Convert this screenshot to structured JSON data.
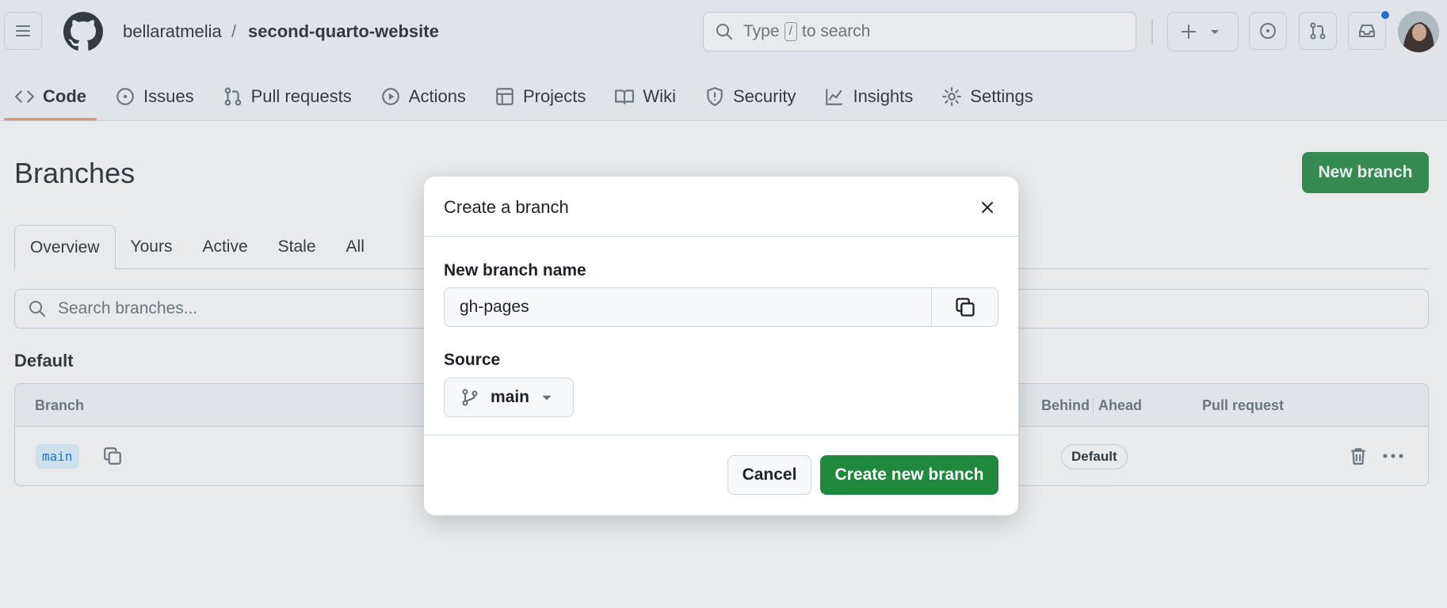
{
  "header": {
    "owner": "bellaratmelia",
    "separator": "/",
    "repo": "second-quarto-website",
    "search_prefix": "Type",
    "search_key": "/",
    "search_suffix": "to search"
  },
  "repo_tabs": [
    {
      "label": "Code",
      "icon": "code-icon"
    },
    {
      "label": "Issues",
      "icon": "issue-icon"
    },
    {
      "label": "Pull requests",
      "icon": "pull-request-icon"
    },
    {
      "label": "Actions",
      "icon": "play-icon"
    },
    {
      "label": "Projects",
      "icon": "table-icon"
    },
    {
      "label": "Wiki",
      "icon": "book-icon"
    },
    {
      "label": "Security",
      "icon": "shield-icon"
    },
    {
      "label": "Insights",
      "icon": "graph-icon"
    },
    {
      "label": "Settings",
      "icon": "gear-icon"
    }
  ],
  "page": {
    "title": "Branches",
    "new_branch_label": "New branch",
    "subtabs": [
      "Overview",
      "Yours",
      "Active",
      "Stale",
      "All"
    ],
    "search_placeholder": "Search branches...",
    "section_label": "Default",
    "table_headers": {
      "branch": "Branch",
      "behind": "Behind",
      "ahead": "Ahead",
      "pull_request": "Pull request"
    },
    "row": {
      "branch": "main",
      "badge": "Default"
    }
  },
  "dialog": {
    "title": "Create a branch",
    "name_label": "New branch name",
    "name_value": "gh-pages",
    "source_label": "Source",
    "source_value": "main",
    "cancel_label": "Cancel",
    "create_label": "Create new branch"
  },
  "colors": {
    "primary": "#1f883d",
    "accent": "#0969da",
    "active_tab": "#fd8c73"
  }
}
